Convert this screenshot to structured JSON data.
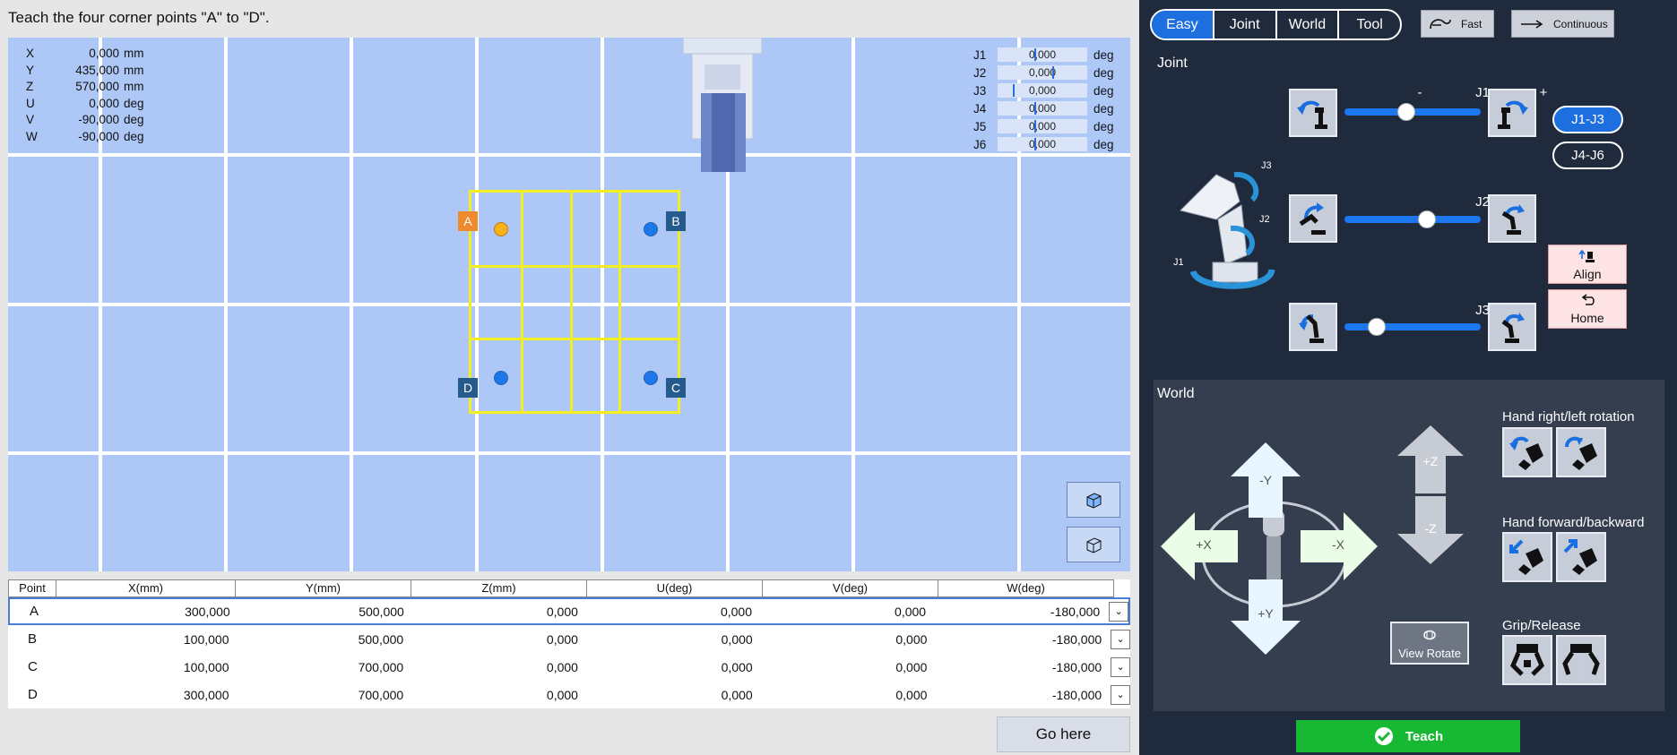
{
  "instruction": "Teach the four corner points \"A\" to \"D\".",
  "coords": [
    {
      "k": "X",
      "v": "0,000",
      "u": "mm"
    },
    {
      "k": "Y",
      "v": "435,000",
      "u": "mm"
    },
    {
      "k": "Z",
      "v": "570,000",
      "u": "mm"
    },
    {
      "k": "U",
      "v": "0,000",
      "u": "deg"
    },
    {
      "k": "V",
      "v": "-90,000",
      "u": "deg"
    },
    {
      "k": "W",
      "v": "-90,000",
      "u": "deg"
    }
  ],
  "joints": [
    {
      "k": "J1",
      "v": "0,000",
      "u": "deg",
      "level": 0.42
    },
    {
      "k": "J2",
      "v": "0,000",
      "u": "deg",
      "level": 0.62
    },
    {
      "k": "J3",
      "v": "0,000",
      "u": "deg",
      "level": 0.17
    },
    {
      "k": "J4",
      "v": "0,000",
      "u": "deg",
      "level": 0.42
    },
    {
      "k": "J5",
      "v": "0,000",
      "u": "deg",
      "level": 0.42
    },
    {
      "k": "J6",
      "v": "0,000",
      "u": "deg",
      "level": 0.42
    }
  ],
  "points": {
    "a": "A",
    "b": "B",
    "c": "C",
    "d": "D"
  },
  "table": {
    "headers": [
      "Point",
      "X(mm)",
      "Y(mm)",
      "Z(mm)",
      "U(deg)",
      "V(deg)",
      "W(deg)"
    ],
    "rows": [
      [
        "A",
        "300,000",
        "500,000",
        "0,000",
        "0,000",
        "0,000",
        "-180,000"
      ],
      [
        "B",
        "100,000",
        "500,000",
        "0,000",
        "0,000",
        "0,000",
        "-180,000"
      ],
      [
        "C",
        "100,000",
        "700,000",
        "0,000",
        "0,000",
        "0,000",
        "-180,000"
      ],
      [
        "D",
        "300,000",
        "700,000",
        "0,000",
        "0,000",
        "0,000",
        "-180,000"
      ]
    ]
  },
  "go_here": "Go here",
  "tabs": [
    {
      "label": "Easy",
      "active": true
    },
    {
      "label": "Joint",
      "active": false
    },
    {
      "label": "World",
      "active": false
    },
    {
      "label": "Tool",
      "active": false
    }
  ],
  "speed": "Fast",
  "mode": "Continuous",
  "joint_section": {
    "title": "Joint",
    "j1": "J1",
    "j2": "J2",
    "j3": "J3",
    "minus": "-",
    "plus": "+",
    "slider_j1": 0.45,
    "slider_j2": 0.62,
    "slider_j3": 0.2,
    "diagram_labels": {
      "j1": "J1",
      "j2": "J2",
      "j3": "J3"
    },
    "group_a": "J1-J3",
    "group_b": "J4-J6",
    "align": "Align",
    "home": "Home"
  },
  "world_section": {
    "title": "World",
    "minus_y": "-Y",
    "plus_y": "+Y",
    "plus_x": "+X",
    "minus_x": "-X",
    "plus_z": "+Z",
    "minus_z": "-Z",
    "rotation_label": "Hand right/left rotation",
    "fwd_label": "Hand forward/backward",
    "grip_label": "Grip/Release",
    "view_rotate": "View Rotate"
  },
  "teach": "Teach",
  "colors": {
    "accent": "#1d6fe0",
    "teach": "#17b833",
    "grid_line": "#f2ee20",
    "view_bg": "#adc8f6",
    "panel_bg": "#1f2a3c"
  }
}
